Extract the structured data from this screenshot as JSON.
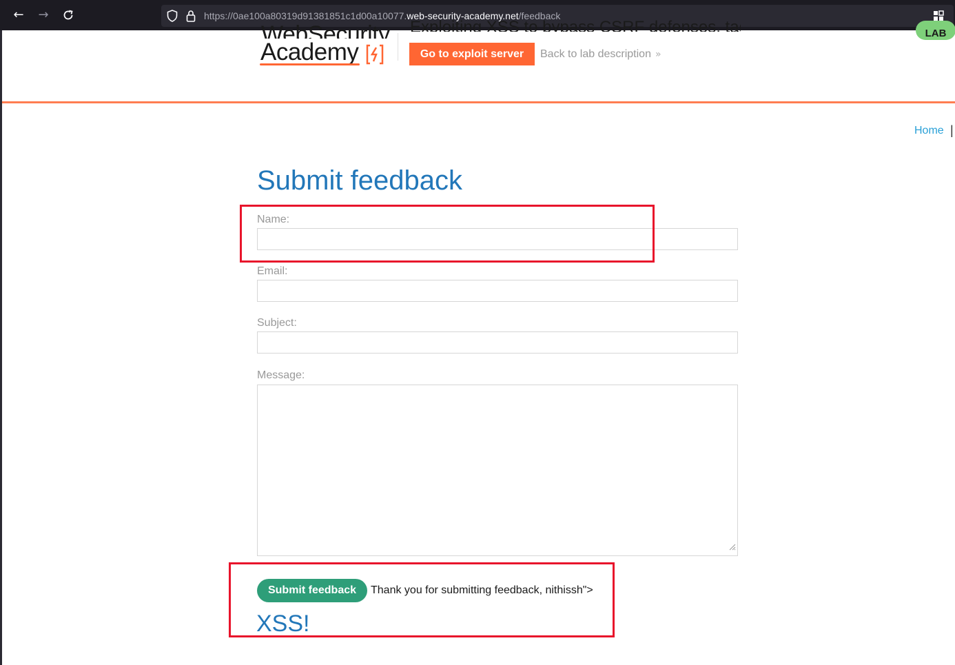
{
  "browser": {
    "url_prefix": "https://0ae100a80319d91381851c1d00a10077.",
    "url_domain": "web-security-academy.net",
    "url_path": "/feedback"
  },
  "header": {
    "logo_line1": "WebSecurity",
    "logo_line2": "Academy",
    "lab_title": "Exploiting XSS to bypass CSRF defenses, tagged",
    "exploit_button": "Go to exploit server",
    "back_link": "Back to lab description",
    "status_badge": "LAB"
  },
  "nav": {
    "home": "Home",
    "separator": "|"
  },
  "form": {
    "title": "Submit feedback",
    "name_label": "Name:",
    "email_label": "Email:",
    "subject_label": "Subject:",
    "message_label": "Message:",
    "submit_label": "Submit feedback"
  },
  "result": {
    "thanks": "Thank you for submitting feedback, nithissh\">",
    "injected_heading": "XSS!"
  },
  "colors": {
    "accent_orange": "#ff6633",
    "title_blue": "#2277b9",
    "submit_green": "#2e9e79",
    "highlight_red": "#e8142b"
  },
  "icons": [
    "back-arrow-icon",
    "forward-arrow-icon",
    "reload-icon",
    "shield-icon",
    "lock-icon",
    "extensions-icon",
    "chevron-double-right-icon",
    "resize-grip-icon"
  ]
}
